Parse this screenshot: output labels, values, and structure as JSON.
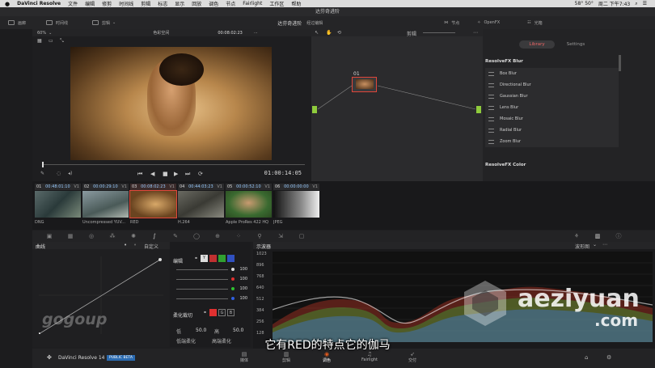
{
  "menubar": {
    "app": "DaVinci Resolve",
    "items": [
      "文件",
      "编辑",
      "修剪",
      "时间线",
      "剪辑",
      "标志",
      "显示",
      "回放",
      "调色",
      "节点",
      "Fairlight",
      "工作区",
      "帮助"
    ],
    "status": [
      "58° 50°",
      "周二 下午7:43"
    ]
  },
  "window_title": "达芬奇进阶",
  "toolbar": {
    "media": "画廊",
    "timeline": "时间线",
    "clips": "剪辑",
    "project_title": "达芬奇进阶",
    "edited": "经过编辑",
    "nodes": "节点",
    "openfx": "OpenFX",
    "lightbox": "光箱"
  },
  "viewer": {
    "zoom": "60%",
    "colorspace": "色彩空间",
    "timecode_top": "00:08:02:23",
    "clip_label": "剪辑",
    "timecode_main": "01:00:14:05"
  },
  "node_editor": {
    "node_label": "01"
  },
  "library": {
    "tabs": [
      "Library",
      "Settings"
    ],
    "section_blur": "ResolveFX Blur",
    "blur_items": [
      "Box Blur",
      "Directional Blur",
      "Gaussian Blur",
      "Lens Blur",
      "Mosaic Blur",
      "Radial Blur",
      "Zoom Blur"
    ],
    "section_color": "ResolveFX Color"
  },
  "clips": [
    {
      "num": "01",
      "tc": "00:48:01:10",
      "track": "V1",
      "label": "DNG"
    },
    {
      "num": "02",
      "tc": "00:00:29:10",
      "track": "V1",
      "label": "Uncompressed YUV..."
    },
    {
      "num": "03",
      "tc": "00:08:02:23",
      "track": "V1",
      "label": "RED"
    },
    {
      "num": "04",
      "tc": "00:44:03:23",
      "track": "V1",
      "label": "H.264"
    },
    {
      "num": "05",
      "tc": "00:00:52:10",
      "track": "V1",
      "label": "Apple ProRes 422 HQ"
    },
    {
      "num": "06",
      "tc": "00:00:00:00",
      "track": "V1",
      "label": "JPEG"
    }
  ],
  "curves": {
    "title": "曲线",
    "mode": "自定义"
  },
  "mixer": {
    "edit_label": "编辑",
    "values": [
      "100",
      "100",
      "100",
      "100"
    ],
    "soft_clip": "柔化裁切",
    "low_label": "低",
    "low_val": "50.0",
    "high_label": "高",
    "high_val": "50.0",
    "low_soft": "低端柔化",
    "high_soft": "高端柔化"
  },
  "scopes": {
    "title": "示波器",
    "mode": "波形图",
    "ticks": [
      "1023",
      "896",
      "768",
      "640",
      "512",
      "384",
      "256",
      "128"
    ]
  },
  "bottom_nav": {
    "app_name": "DaVinci Resolve 14",
    "badge": "PUBLIC BETA",
    "pages": [
      "媒体",
      "剪辑",
      "调色",
      "Fairlight",
      "交付"
    ]
  },
  "subtitle": "它有RED的特点它的伽马",
  "watermarks": [
    "gogoup",
    "aeziyuan",
    ".com"
  ],
  "colors": {
    "accent_red": "#e0463a",
    "brand_orange": "#e05a1e"
  }
}
